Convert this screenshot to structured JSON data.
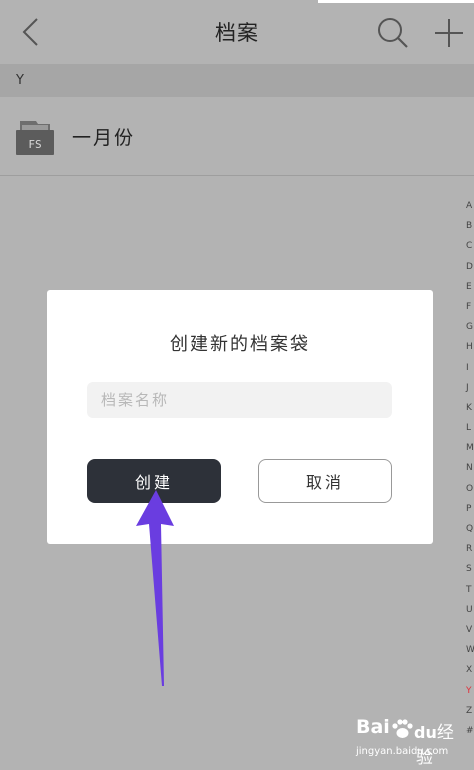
{
  "header": {
    "title": "档案"
  },
  "section": {
    "label": "Y"
  },
  "list": {
    "items": [
      {
        "label": "一月份",
        "icon_text": "FS"
      }
    ]
  },
  "index": {
    "letters": [
      "A",
      "B",
      "C",
      "D",
      "E",
      "F",
      "G",
      "H",
      "I",
      "J",
      "K",
      "L",
      "M",
      "N",
      "O",
      "P",
      "Q",
      "R",
      "S",
      "T",
      "U",
      "V",
      "W",
      "X",
      "Y",
      "Z",
      "#"
    ],
    "active": "Y"
  },
  "dialog": {
    "title": "创建新的档案袋",
    "input_placeholder": "档案名称",
    "input_value": "",
    "create_label": "创建",
    "cancel_label": "取消"
  },
  "watermark": {
    "logo": "Bai",
    "logo_suffix": "du",
    "text": "经验",
    "url": "jingyan.baidu.com"
  },
  "colors": {
    "overlay": "#b3b3b3",
    "primary_button": "#2d3139",
    "arrow": "#6a3de0",
    "active_index": "#e0303a"
  },
  "icons": [
    "back-icon",
    "search-icon",
    "plus-icon",
    "folder-icon",
    "baidu-paw-icon"
  ]
}
